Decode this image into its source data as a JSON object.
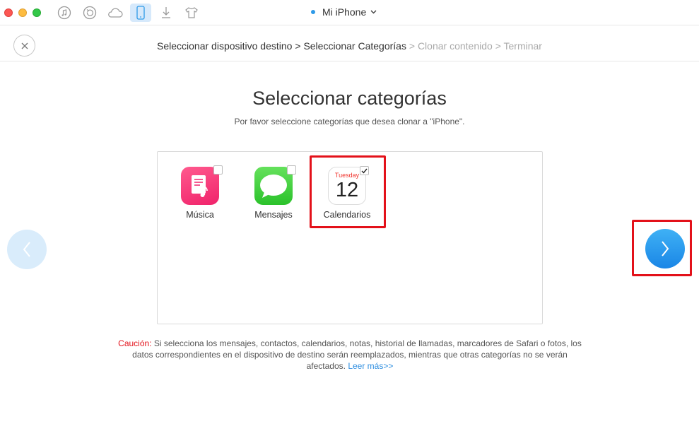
{
  "titlebar": {
    "device_name": "Mi iPhone",
    "toolbar_icons": [
      "itunes-icon",
      "restore-icon",
      "icloud-icon",
      "phone-icon",
      "download-icon",
      "tshirt-icon"
    ]
  },
  "breadcrumb": {
    "step1": "Seleccionar dispositivo destino",
    "sep": ">",
    "step2": "Seleccionar Categorías",
    "step3": "Clonar contenido",
    "step4": "Terminar"
  },
  "main": {
    "title": "Seleccionar categorías",
    "subtitle": "Por favor seleccione categorías que desea clonar a \"iPhone\"."
  },
  "categories": [
    {
      "label": "Música",
      "checked": false,
      "icon": "music-icon"
    },
    {
      "label": "Mensajes",
      "checked": false,
      "icon": "messages-icon"
    },
    {
      "label": "Calendarios",
      "checked": true,
      "icon": "calendar-icon",
      "cal_day": "Tuesday",
      "cal_num": "12"
    }
  ],
  "caution": {
    "prefix": "Caución:",
    "text": " Si selecciona los mensajes, contactos, calendarios, notas, historial de llamadas, marcadores de Safari o fotos, los datos correspondientes en el dispositivo de destino serán reemplazados, mientras que otras categorías no se verán afectados. ",
    "link": "Leer más>>"
  },
  "colors": {
    "accent": "#2e9ae8",
    "highlight": "#e3111a"
  }
}
